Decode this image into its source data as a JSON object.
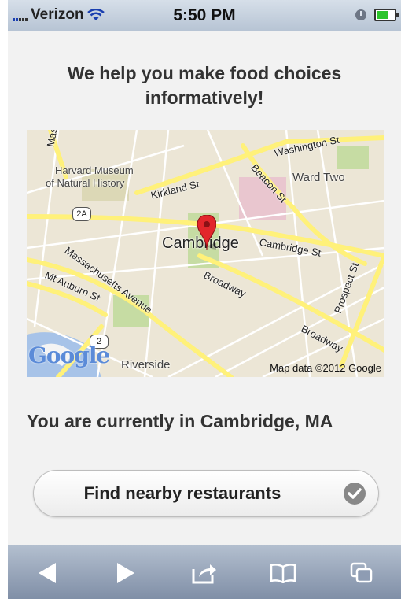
{
  "status_bar": {
    "carrier": "Verizon",
    "time": "5:50 PM",
    "icons": [
      "signal-icon",
      "wifi-icon",
      "clock-icon",
      "battery-icon"
    ]
  },
  "headline": "We help you make food choices informatively!",
  "map": {
    "place_labels": {
      "harvard_museum_1": "Harvard Museum",
      "harvard_museum_2": "of Natural History",
      "ward_two": "Ward Two",
      "cambridge": "Cambridge",
      "riverside": "Riverside"
    },
    "road_labels": {
      "washington": "Washington St",
      "kirkland": "Kirkland St",
      "beacon": "Beacon St",
      "cambridge_st": "Cambridge St",
      "massachusetts": "Massachusetts Avenue",
      "mt_auburn": "Mt Auburn St",
      "broadway1": "Broadway",
      "broadway2": "Broadway",
      "prospect": "Prospect St",
      "mass_fragment": "Mas"
    },
    "route_shields": [
      "2A",
      "2"
    ],
    "logo": "Google",
    "credit": "Map data ©2012 Google",
    "colors": {
      "land": "#ece6d6",
      "major_road": "#fff17a",
      "water": "#a7c3e8",
      "park": "#c6dca3"
    }
  },
  "location_text": "You are currently in Cambridge, MA",
  "find_button": {
    "label": "Find nearby restaurants"
  },
  "toolbar": {
    "icons": [
      "back-arrow-icon",
      "forward-arrow-icon",
      "share-icon",
      "bookmarks-icon",
      "tabs-icon"
    ]
  }
}
